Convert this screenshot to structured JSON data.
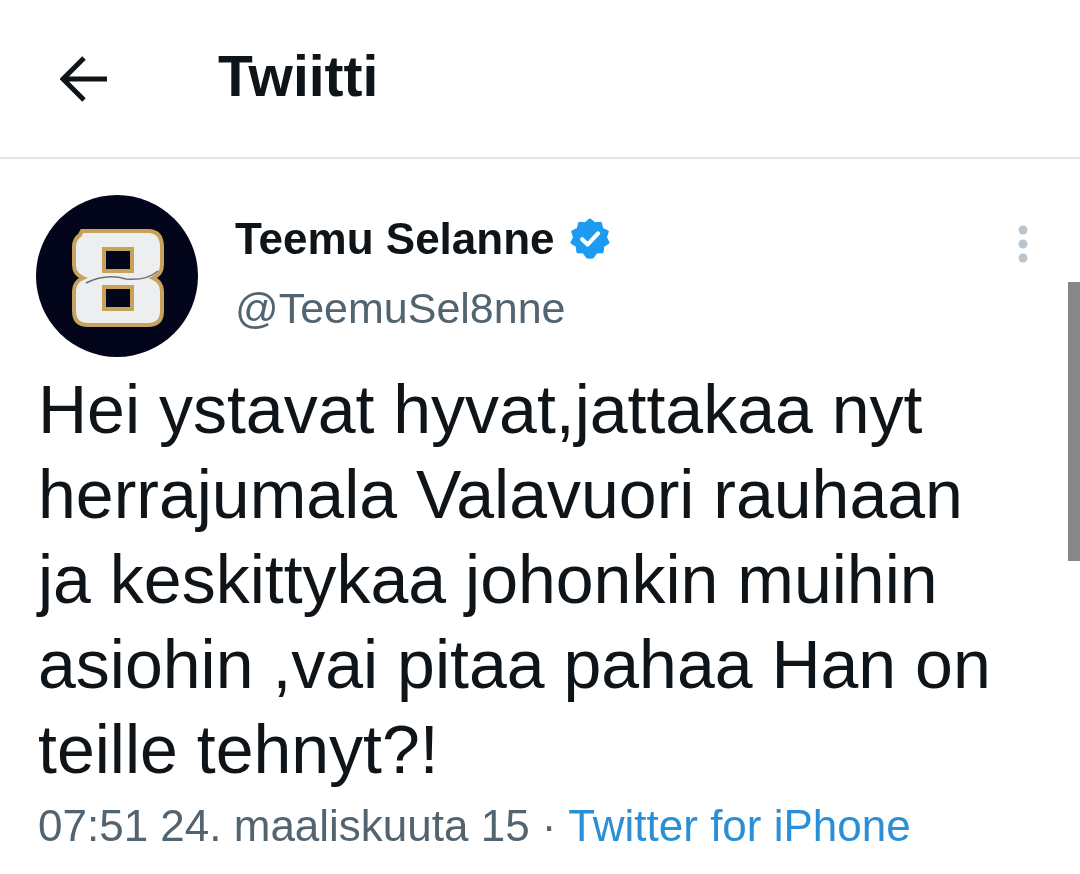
{
  "header": {
    "title": "Twiitti"
  },
  "tweet": {
    "author": {
      "name": "Teemu Selanne",
      "verified": true,
      "handle": "@TeemuSel8nne"
    },
    "text": "Hei ystavat hyvat,jattakaa nyt herrajumala Valavuori rauhaan ja keskittykaa johonkin muihin asiohin ,vai pitaa pahaa Han on teille tehnyt?!",
    "timestamp": "07:51 24. maaliskuuta 15",
    "separator": "·",
    "source": "Twitter for iPhone"
  }
}
